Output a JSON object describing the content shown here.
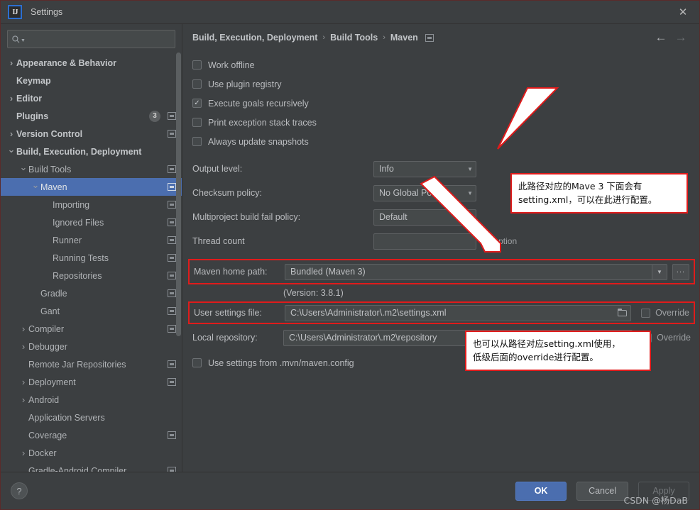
{
  "window": {
    "title": "Settings",
    "logo_text": "IJ",
    "close_label": "✕"
  },
  "sidebar": {
    "search_placeholder": "",
    "search_value": "",
    "search_icon": "search-icon",
    "items": [
      {
        "label": "Appearance & Behavior",
        "indent": 0,
        "arrow": "right",
        "bold": true,
        "cfg": false,
        "badge": "",
        "selected": false
      },
      {
        "label": "Keymap",
        "indent": 0,
        "arrow": "none",
        "bold": true,
        "cfg": false,
        "badge": "",
        "selected": false
      },
      {
        "label": "Editor",
        "indent": 0,
        "arrow": "right",
        "bold": true,
        "cfg": false,
        "badge": "",
        "selected": false
      },
      {
        "label": "Plugins",
        "indent": 0,
        "arrow": "none",
        "bold": true,
        "cfg": true,
        "badge": "3",
        "selected": false
      },
      {
        "label": "Version Control",
        "indent": 0,
        "arrow": "right",
        "bold": true,
        "cfg": true,
        "badge": "",
        "selected": false
      },
      {
        "label": "Build, Execution, Deployment",
        "indent": 0,
        "arrow": "down",
        "bold": true,
        "cfg": false,
        "badge": "",
        "selected": false
      },
      {
        "label": "Build Tools",
        "indent": 1,
        "arrow": "down",
        "bold": false,
        "cfg": true,
        "badge": "",
        "selected": false
      },
      {
        "label": "Maven",
        "indent": 2,
        "arrow": "down",
        "bold": false,
        "cfg": true,
        "badge": "",
        "selected": true
      },
      {
        "label": "Importing",
        "indent": 3,
        "arrow": "none",
        "bold": false,
        "cfg": true,
        "badge": "",
        "selected": false
      },
      {
        "label": "Ignored Files",
        "indent": 3,
        "arrow": "none",
        "bold": false,
        "cfg": true,
        "badge": "",
        "selected": false
      },
      {
        "label": "Runner",
        "indent": 3,
        "arrow": "none",
        "bold": false,
        "cfg": true,
        "badge": "",
        "selected": false
      },
      {
        "label": "Running Tests",
        "indent": 3,
        "arrow": "none",
        "bold": false,
        "cfg": true,
        "badge": "",
        "selected": false
      },
      {
        "label": "Repositories",
        "indent": 3,
        "arrow": "none",
        "bold": false,
        "cfg": true,
        "badge": "",
        "selected": false
      },
      {
        "label": "Gradle",
        "indent": 2,
        "arrow": "none",
        "bold": false,
        "cfg": true,
        "badge": "",
        "selected": false
      },
      {
        "label": "Gant",
        "indent": 2,
        "arrow": "none",
        "bold": false,
        "cfg": true,
        "badge": "",
        "selected": false
      },
      {
        "label": "Compiler",
        "indent": 1,
        "arrow": "right",
        "bold": false,
        "cfg": true,
        "badge": "",
        "selected": false
      },
      {
        "label": "Debugger",
        "indent": 1,
        "arrow": "right",
        "bold": false,
        "cfg": false,
        "badge": "",
        "selected": false
      },
      {
        "label": "Remote Jar Repositories",
        "indent": 1,
        "arrow": "none",
        "bold": false,
        "cfg": true,
        "badge": "",
        "selected": false
      },
      {
        "label": "Deployment",
        "indent": 1,
        "arrow": "right",
        "bold": false,
        "cfg": true,
        "badge": "",
        "selected": false
      },
      {
        "label": "Android",
        "indent": 1,
        "arrow": "right",
        "bold": false,
        "cfg": false,
        "badge": "",
        "selected": false
      },
      {
        "label": "Application Servers",
        "indent": 1,
        "arrow": "none",
        "bold": false,
        "cfg": false,
        "badge": "",
        "selected": false
      },
      {
        "label": "Coverage",
        "indent": 1,
        "arrow": "none",
        "bold": false,
        "cfg": true,
        "badge": "",
        "selected": false
      },
      {
        "label": "Docker",
        "indent": 1,
        "arrow": "right",
        "bold": false,
        "cfg": false,
        "badge": "",
        "selected": false
      },
      {
        "label": "Gradle-Android Compiler",
        "indent": 1,
        "arrow": "none",
        "bold": false,
        "cfg": true,
        "badge": "",
        "selected": false
      }
    ]
  },
  "breadcrumb": {
    "parts": [
      "Build, Execution, Deployment",
      "Build Tools",
      "Maven"
    ],
    "separator": "›",
    "back_label": "←",
    "forward_label": "→"
  },
  "main": {
    "checkboxes": [
      {
        "label": "Work offline",
        "checked": false
      },
      {
        "label": "Use plugin registry",
        "checked": false
      },
      {
        "label": "Execute goals recursively",
        "checked": true
      },
      {
        "label": "Print exception stack traces",
        "checked": false
      },
      {
        "label": "Always update snapshots",
        "checked": false
      }
    ],
    "check_glyph": "✓",
    "combos": [
      {
        "label": "Output level:",
        "value": "Info"
      },
      {
        "label": "Checksum policy:",
        "value": "No Global Policy"
      },
      {
        "label": "Multiproject build fail policy:",
        "value": "Default"
      }
    ],
    "thread_count": {
      "label": "Thread count",
      "value": "",
      "hint": "-T option"
    },
    "maven_home": {
      "label": "Maven home path:",
      "value": "Bundled (Maven 3)",
      "ellipsis_label": "...",
      "version": "(Version: 3.8.1)"
    },
    "user_settings": {
      "label": "User settings file:",
      "value": "C:\\Users\\Administrator\\.m2\\settings.xml",
      "override_label": "Override",
      "override_checked": false
    },
    "local_repository": {
      "label": "Local repository:",
      "value": "C:\\Users\\Administrator\\.m2\\repository",
      "override_label": "Override",
      "override_checked": false
    },
    "mvn_config": {
      "label": "Use settings from .mvn/maven.config",
      "checked": false
    }
  },
  "annotations": [
    {
      "line1": "此路径对应的Mave 3 下面会有",
      "line2": "setting.xml，可以在此进行配置。"
    },
    {
      "line1": "也可以从路径对应setting.xml使用，",
      "line2": "低级后面的override进行配置。"
    }
  ],
  "footer": {
    "help_label": "?",
    "ok_label": "OK",
    "cancel_label": "Cancel",
    "apply_label": "Apply",
    "watermark": "CSDN @杨DaB"
  },
  "colors": {
    "accent": "#4b6eaf",
    "annotation_border": "#e01b1b",
    "background": "#3c3f41",
    "field_bg": "#45494a"
  }
}
